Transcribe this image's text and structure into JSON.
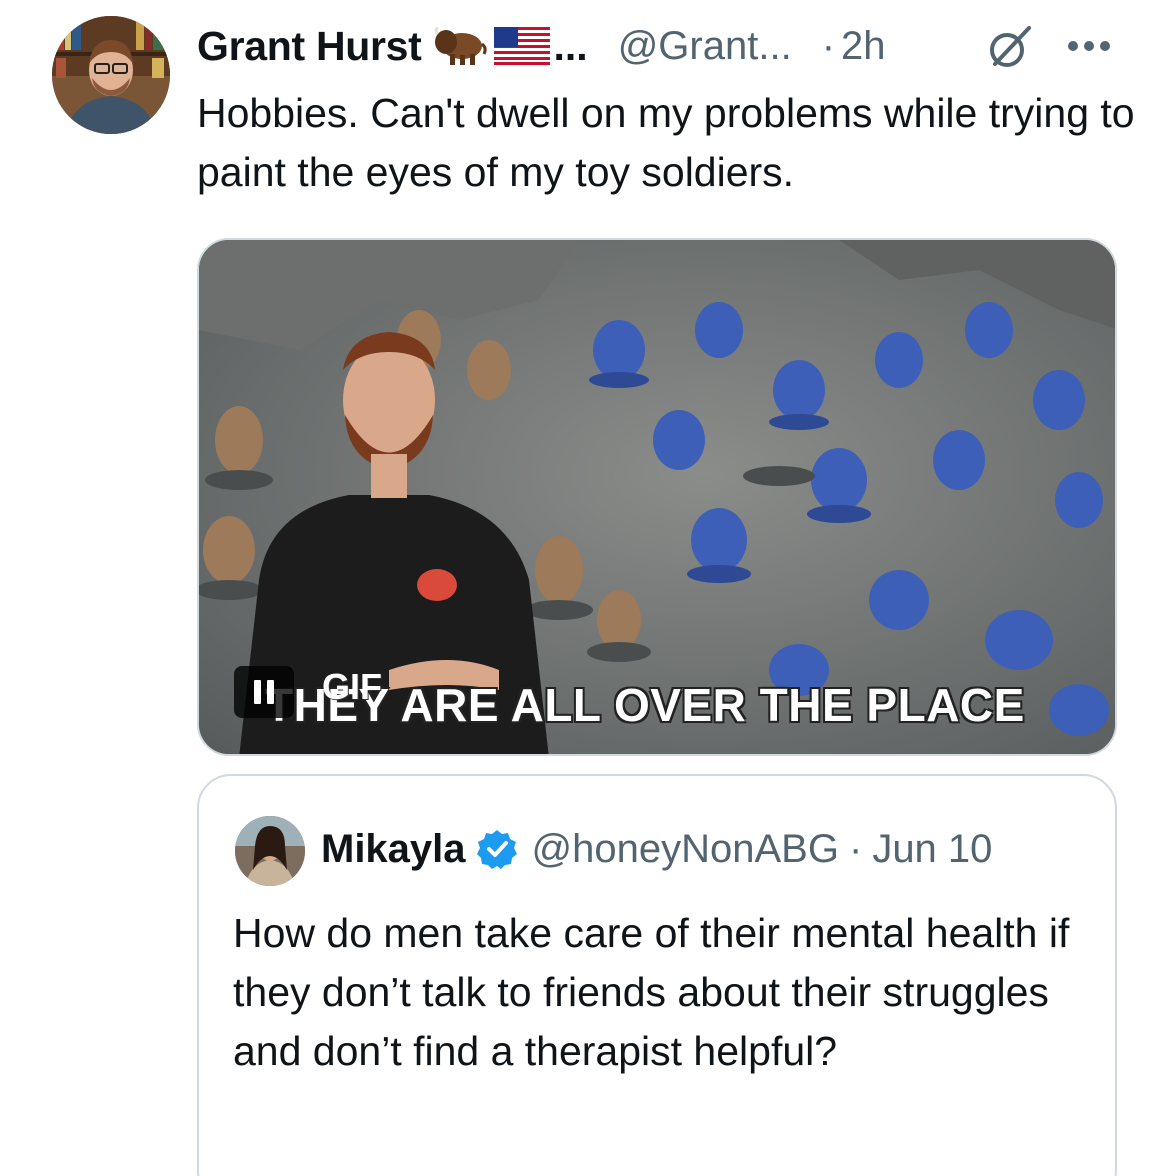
{
  "tweet": {
    "author_name": "Grant Hurst",
    "author_name_ellipsis": "...",
    "handle": "@Grant...",
    "separator": "·",
    "time": "2h",
    "text": "Hobbies. Can't dwell on my problems while trying to paint the eyes of my toy soldiers.",
    "icons": {
      "bison": "bison-emoji",
      "flag": "us-flag-emoji",
      "grok": "grok-icon",
      "more": "more-options-icon"
    }
  },
  "media": {
    "caption": "THEY ARE ALL OVER THE PLACE",
    "gif_badge": "GIF",
    "pause_icon": "pause-icon"
  },
  "quote": {
    "author_name": "Mikayla",
    "handle": "@honeyNonABG",
    "separator": "·",
    "date": "Jun 10",
    "verified_icon": "verified-badge-icon",
    "text": "How do men take care of their mental health if they don’t talk to friends about their struggles and don’t find a therapist helpful?"
  },
  "colors": {
    "text_primary": "#0f1419",
    "text_secondary": "#536471",
    "border": "#cfd9de",
    "verified_blue": "#1d9bf0"
  }
}
